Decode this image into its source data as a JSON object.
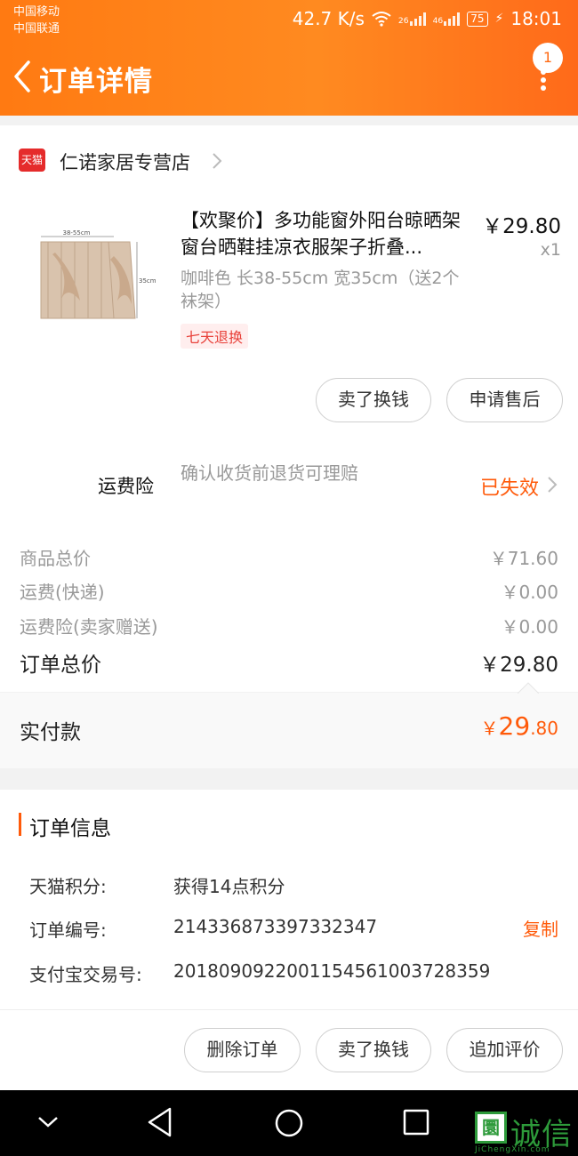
{
  "status_bar": {
    "carrier1": "中国移动",
    "carrier2": "中国联通",
    "net_speed": "42.7 K/s",
    "sig1": "26",
    "sig2": "46",
    "battery": "75",
    "time": "18:01"
  },
  "nav": {
    "title": "订单详情",
    "badge": "1"
  },
  "shop": {
    "logo_text": "天猫",
    "name": "仁诺家居专营店"
  },
  "product": {
    "title": "【欢聚价】多功能窗外阳台晾晒架窗台晒鞋挂凉衣服架子折叠...",
    "price": "￥29.80",
    "qty": "x1",
    "sku": "咖啡色 长38-55cm 宽35cm（送2个袜架）",
    "tag": "七天退换",
    "dim1": "38-55cm",
    "dim2": "35cm"
  },
  "item_actions": {
    "exchange": "卖了换钱",
    "after_sale": "申请售后"
  },
  "insurance": {
    "label": "运费险",
    "desc": "确认收货前退货可理赔",
    "status": "已失效"
  },
  "summary": {
    "goods_label": "商品总价",
    "goods_value": "￥71.60",
    "shipping_label": "运费(快递)",
    "shipping_value": "￥0.00",
    "ins_label": "运费险(卖家赠送)",
    "ins_value": "￥0.00",
    "total_label": "订单总价",
    "total_value": "￥29.80"
  },
  "payment": {
    "label": "实付款",
    "currency": "￥",
    "int": "29",
    "dec": ".80"
  },
  "order_info": {
    "title": "订单信息",
    "points_label": "天猫积分:",
    "points_value": "获得14点积分",
    "order_no_label": "订单编号:",
    "order_no_value": "214336873397332347",
    "copy": "复制",
    "alipay_label": "支付宝交易号:",
    "alipay_value": "2018090922001154561003728359"
  },
  "bottom_actions": {
    "delete": "删除订单",
    "exchange": "卖了换钱",
    "review": "追加评价"
  },
  "watermark": {
    "box": "圜",
    "text": "诚信",
    "sub": "JiChengXin.com"
  },
  "colors": {
    "header": "#ff7a12",
    "accent": "#ff5a0a",
    "tmall_red": "#e52b2b"
  }
}
